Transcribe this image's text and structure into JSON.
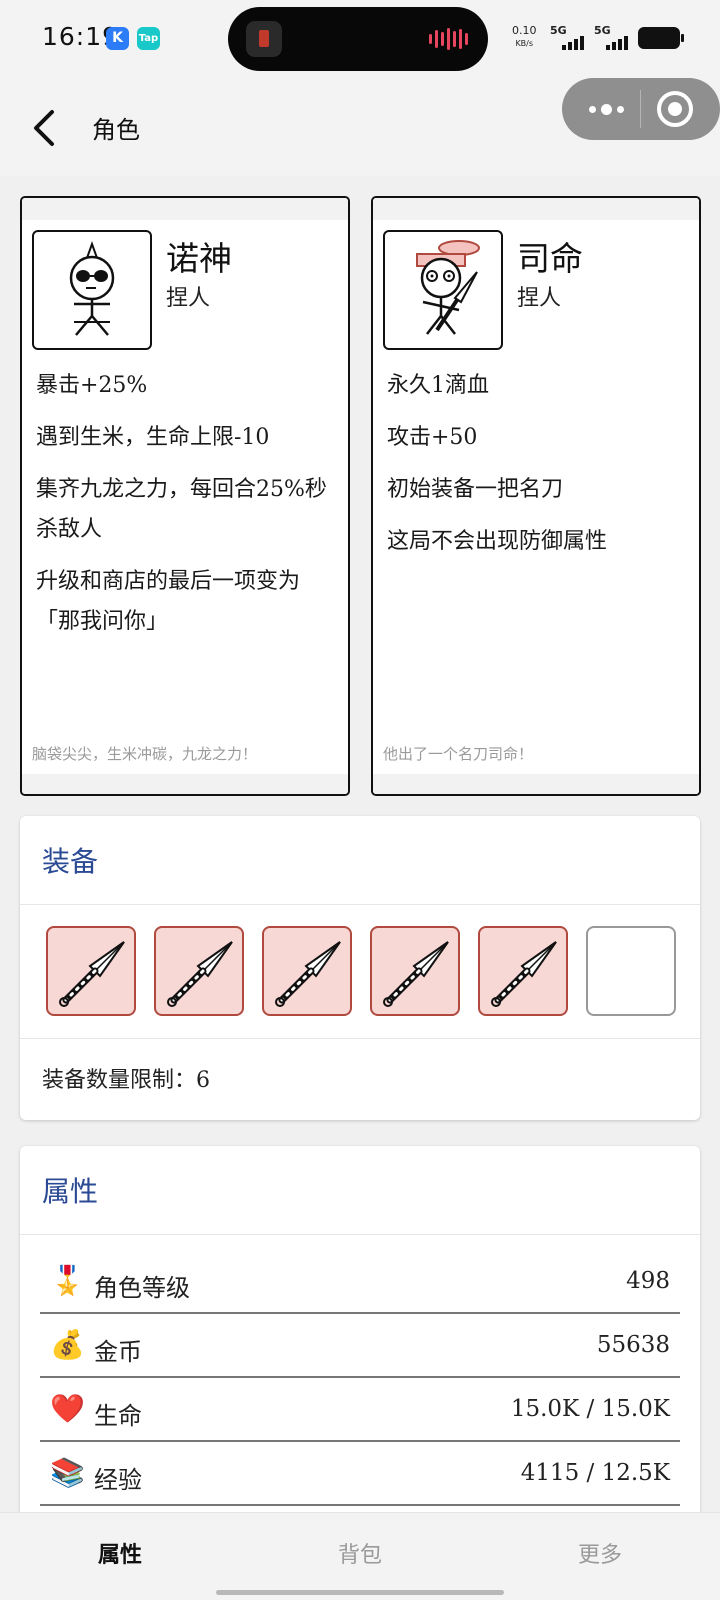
{
  "status_bar": {
    "time": "16:19",
    "app_badges": [
      "K",
      "Tap"
    ],
    "net_speed_value": "0.10",
    "net_speed_unit": "KB/s",
    "signal_1": "5G",
    "signal_2": "5G"
  },
  "header": {
    "title": "角色"
  },
  "characters": [
    {
      "name": "诺神",
      "class": "捏人",
      "traits": [
        "暴击+25%",
        "遇到生米，生命上限-10",
        "集齐九龙之力，每回合25%秒杀敌人",
        "升级和商店的最后一项变为「那我问你」"
      ],
      "quote": "脑袋尖尖，生米冲碳，九龙之力！"
    },
    {
      "name": "司命",
      "class": "捏人",
      "traits": [
        "永久1滴血",
        "攻击+50",
        "初始装备一把名刀",
        "这局不会出现防御属性"
      ],
      "quote": "他出了一个名刀司命！"
    }
  ],
  "equipment": {
    "title": "装备",
    "slots": [
      "kunai",
      "kunai",
      "kunai",
      "kunai",
      "kunai",
      "empty"
    ],
    "limit_text": "装备数量限制：6"
  },
  "attributes": {
    "title": "属性",
    "rows": [
      {
        "icon": "medal-icon",
        "emoji": "🎖️",
        "label": "角色等级",
        "value": "498"
      },
      {
        "icon": "money-bag-icon",
        "emoji": "💰",
        "label": "金币",
        "value": "55638"
      },
      {
        "icon": "heart-icon",
        "emoji": "❤️",
        "label": "生命",
        "value": "15.0K / 15.0K"
      },
      {
        "icon": "books-icon",
        "emoji": "📚",
        "label": "经验",
        "value": "4115 / 12.5K"
      }
    ]
  },
  "tabbar": {
    "tabs": [
      "属性",
      "背包",
      "更多"
    ],
    "active": 0
  },
  "colors": {
    "section_title": "#2b4a94",
    "slot_fill": "#f8d8d5",
    "slot_border": "#b04a3f"
  }
}
